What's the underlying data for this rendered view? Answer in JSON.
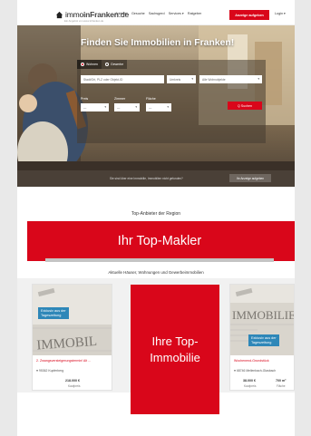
{
  "header": {
    "logo_text_a": "immo",
    "logo_text_b": "inFranken",
    "logo_text_c": ".de",
    "logo_sub": "Ein Angebot von www.infranken.de",
    "nav": [
      "Anbieter",
      "Gesuche",
      "Sachsgerd",
      "Services ▾",
      "Ratgeber"
    ],
    "cta": "Anzeige aufgeben",
    "login": "Login ▾"
  },
  "hero": {
    "title": "Finden Sie Immobilien in Franken!",
    "tab_rent": "Wohnen",
    "tab_buy": "Gewerbe",
    "location_placeholder": "Stadt/Ort, PLZ oder Objekt-ID",
    "radius": "Umkreis",
    "type": "Alle Wohnobjekte",
    "price_label": "Preis",
    "rooms_label": "Zimmer",
    "area_label": "Fläche",
    "dash": "—",
    "search_button": "Q Suchen",
    "strip_text": "Sie sind über eine Immobilie, Immobilien nicht gefunden?",
    "strip_button": "Ihr Anzeige aufgeben"
  },
  "top_anbieter": {
    "title": "Top-Anbieter der Region",
    "makler": "Ihr Top-Makler"
  },
  "listings": {
    "title": "Aktuelle Häuser, Wohnungen und Gewerbeimmobilien",
    "promo_line1": "Ihre Top-",
    "promo_line2": "Immobilie",
    "cards": [
      {
        "tag_line1": "Exklusiv aus der",
        "tag_line2": "Tageszeitung",
        "paper_word": "IMMOBIL",
        "title": "2. Zwangsversteigerungstermin! Alt ...",
        "location": "♥ 95362 Kupferberg",
        "price": "218.000 €",
        "price_sub": "Kaufpreis"
      },
      {
        "tag_line1": "Exklusiv aus der",
        "tag_line2": "Tageszeitung",
        "paper_word": "IMMOBILIE",
        "title": "Wochenend-Grundstück",
        "location": "♥ 68746 Mellenbach-Glasbach",
        "price": "38.000 €",
        "price_sub": "Kaufpreis",
        "area": "700 m²",
        "area_sub": "Fläche"
      }
    ]
  },
  "colors": {
    "brand_red": "#d9061a",
    "tag_blue": "#2e87b8"
  }
}
